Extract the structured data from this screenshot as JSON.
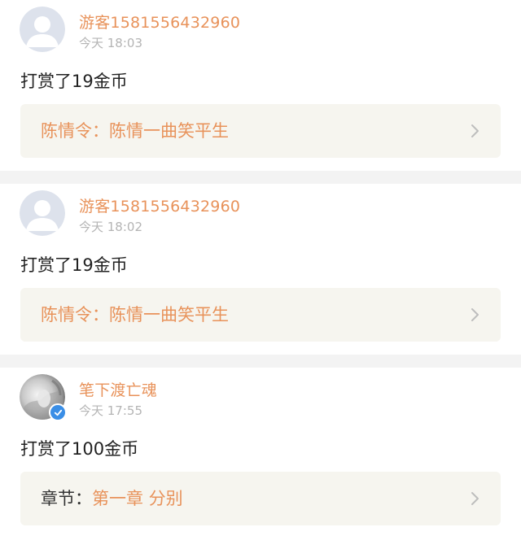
{
  "feed": [
    {
      "username": "游客1581556432960",
      "time": "今天 18:03",
      "action": "打赏了19金币",
      "ref_label": "陈情令：",
      "ref_value": "陈情一曲笑平生",
      "avatar": "default-person-avatar",
      "verified": false
    },
    {
      "username": "游客1581556432960",
      "time": "今天 18:02",
      "action": "打赏了19金币",
      "ref_label": "陈情令：",
      "ref_value": "陈情一曲笑平生",
      "avatar": "default-person-avatar",
      "verified": false
    },
    {
      "username": "笔下渡亡魂",
      "time": "今天 17:55",
      "action": "打赏了100金币",
      "ref_label": "章节：",
      "ref_value": "第一章 分别",
      "avatar": "photo-avatar",
      "verified": true
    }
  ],
  "icons": {
    "chevron": "chevron-right-icon",
    "verified": "verified-check-icon"
  },
  "colors": {
    "accent": "#e8925a",
    "time": "#b4b4b4",
    "ref_bg": "#f6f5ef",
    "separator": "#f3f3f3",
    "verified": "#3a8ee6"
  }
}
